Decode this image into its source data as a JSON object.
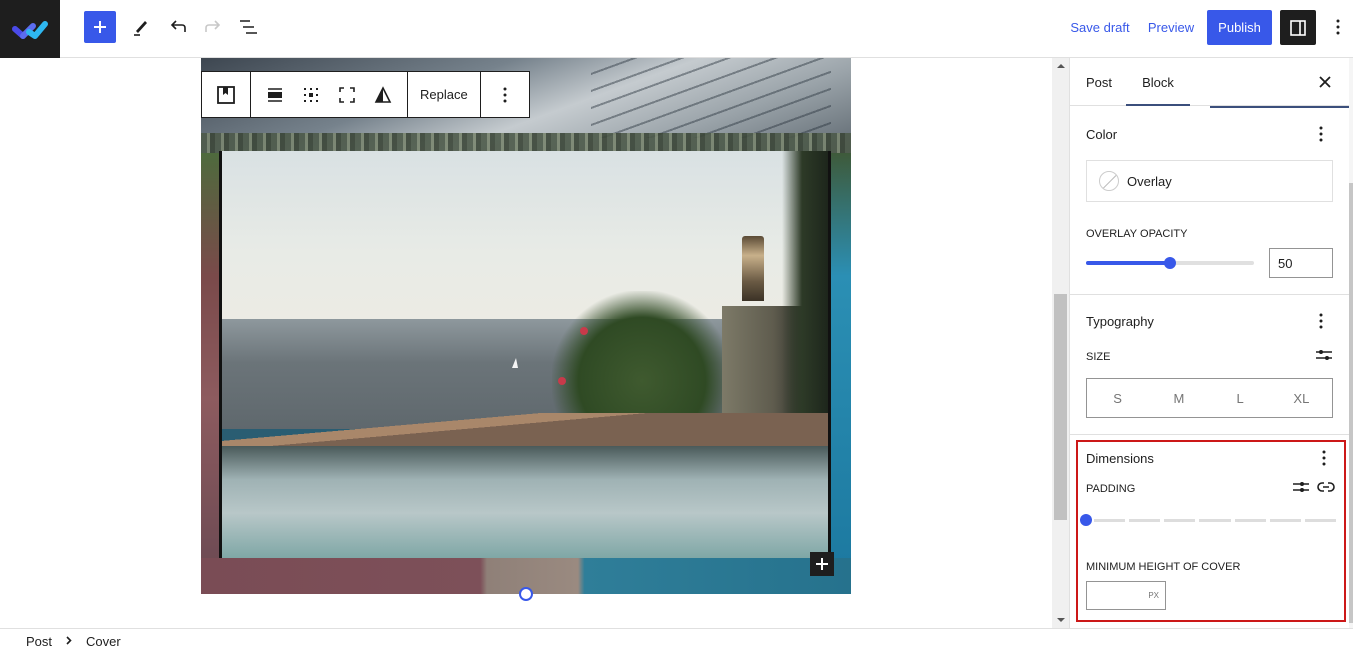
{
  "header": {
    "logo": "wordpress-editor-logo",
    "add_block_label": "+",
    "tools": [
      "edit-tool",
      "undo",
      "redo",
      "document-overview"
    ],
    "save_draft": "Save draft",
    "preview": "Preview",
    "publish": "Publish"
  },
  "block_toolbar": {
    "replace": "Replace"
  },
  "canvas": {
    "cover_alt": "Infinity pool overlooking the sea"
  },
  "sidebar": {
    "tabs": [
      {
        "label": "Post",
        "active": false
      },
      {
        "label": "Block",
        "active": true
      }
    ],
    "color_panel": {
      "title": "Color",
      "overlay_label": "Overlay",
      "overlay_opacity_label": "Overlay opacity",
      "overlay_opacity_value": "50",
      "overlay_opacity_percent": 50
    },
    "typography_panel": {
      "title": "Typography",
      "size_label": "Size",
      "sizes": [
        "S",
        "M",
        "L",
        "XL"
      ]
    },
    "dimensions_panel": {
      "title": "Dimensions",
      "padding_label": "Padding",
      "padding_value_steps": 0,
      "padding_steps_total": 7,
      "min_height_label": "Minimum height of cover",
      "min_height_value": "",
      "min_height_unit": "PX"
    }
  },
  "breadcrumb": [
    "Post",
    "Cover"
  ],
  "colors": {
    "accent": "#3858e9",
    "dark": "#1e1e1e",
    "highlight_border": "#cc1818"
  }
}
